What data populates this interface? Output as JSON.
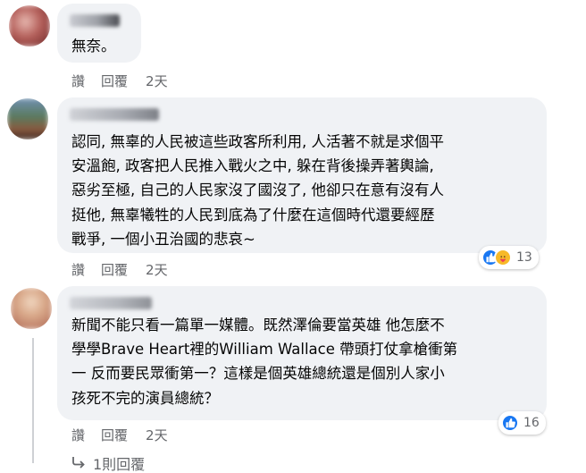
{
  "comments": [
    {
      "author": "",
      "lines": [
        "無奈。"
      ],
      "actions": {
        "like": "讚",
        "reply": "回覆",
        "time": "2天"
      }
    },
    {
      "author": "",
      "lines": [
        "認同, 無辜的人民被這些政客所利用, 人活著不就是求個平",
        "安溫飽, 政客把人民推入戰火之中, 躲在背後操弄著輿論,",
        "惡劣至極, 自己的人民家沒了國沒了, 他卻只在意有沒有人",
        "挺他, 無辜犧牲的人民到底為了什麼在這個時代還要經歷",
        "戰爭, 一個小丑治國的悲哀~"
      ],
      "actions": {
        "like": "讚",
        "reply": "回覆",
        "time": "2天"
      },
      "reactions": {
        "icons": [
          "like-icon",
          "care-icon"
        ],
        "count": "13"
      }
    },
    {
      "author": "",
      "lines": [
        "新聞不能只看一篇單一媒體。既然澤倫要當英雄 他怎麼不",
        "學學Brave Heart裡的William Wallace 帶頭打仗拿槍衝第",
        "一 反而要民眾衝第一？這樣是個英雄總統還是個別人家小",
        "孩死不完的演員總統？"
      ],
      "actions": {
        "like": "讚",
        "reply": "回覆",
        "time": "2天"
      },
      "reactions": {
        "icons": [
          "like-icon"
        ],
        "count": "16"
      }
    }
  ],
  "more_replies": {
    "icon": "reply-arrow-icon",
    "label": "1則回覆"
  },
  "colors": {
    "bubble": "#f0f2f5",
    "secondary_text": "#65676b",
    "like_blue": "#1877f2",
    "care_yellow": "#f7b928"
  }
}
